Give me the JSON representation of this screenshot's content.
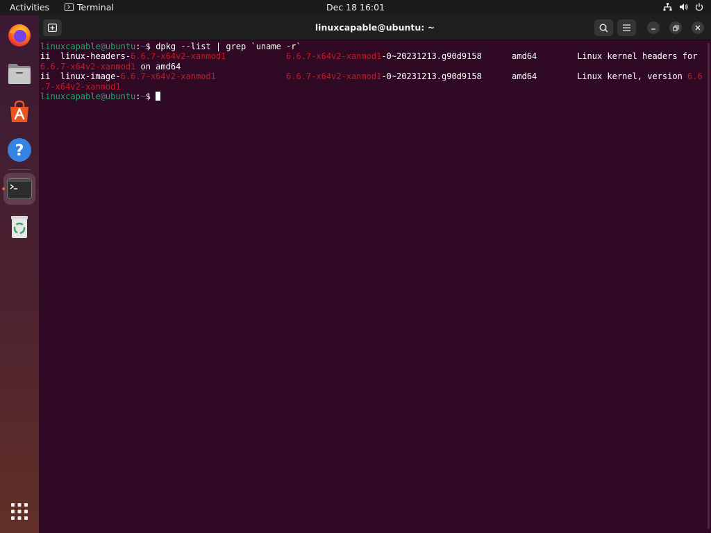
{
  "topbar": {
    "activities": "Activities",
    "app_name": "Terminal",
    "clock": "Dec 18  16:01",
    "tray_icons": [
      "network-icon",
      "volume-icon",
      "power-icon"
    ]
  },
  "dock": {
    "items": [
      "firefox-icon",
      "files-icon",
      "app-center-icon",
      "help-icon",
      "terminal-icon",
      "trash-icon"
    ],
    "show_apps": "show-apps-icon",
    "accent": "#e95420"
  },
  "window": {
    "title": "linuxcapable@ubuntu: ~",
    "background": "#300a24"
  },
  "terminal": {
    "prompt_user": "linuxcapable@ubuntu",
    "prompt_sep": ":",
    "prompt_dir": "~",
    "prompt_dollar": "$ ",
    "command": "dpkg --list | grep `uname -r`",
    "row1": {
      "a": "ii  linux-headers-",
      "b": "6.6.7-x64v2-xanmod1",
      "c": "            ",
      "d": "6.6.7-x64v2-xanmod1",
      "e": "-0~20231213.g90d9158      amd64        Linux kernel headers for"
    },
    "row1_wrap": {
      "a": "6.6.7-x64v2-xanmod1",
      "b": " on amd64"
    },
    "row2": {
      "a": "ii  linux-image-",
      "b": "6.6.7-x64v2-xanmod1",
      "c": "              ",
      "d": "6.6.7-x64v2-xanmod1",
      "e": "-0~20231213.g90d9158      amd64        Linux kernel, version ",
      "f": "6.6"
    },
    "row2_wrap": {
      "a": ".7-x64v2-xanmod1"
    }
  }
}
